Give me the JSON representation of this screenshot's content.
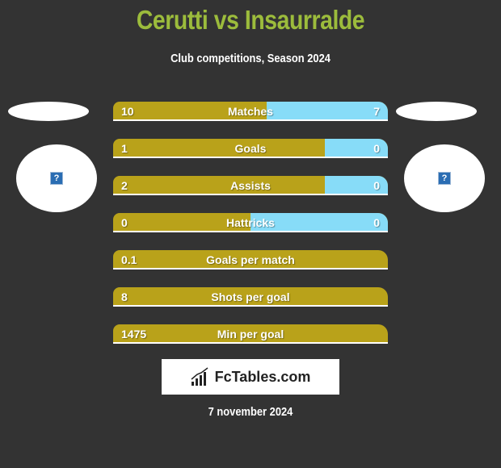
{
  "header": {
    "title": "Cerutti vs Insaurralde",
    "subtitle": "Club competitions, Season 2024"
  },
  "players": {
    "left": {
      "image_icon": "broken-image-icon",
      "icon_glyph": "?"
    },
    "right": {
      "image_icon": "broken-image-icon",
      "icon_glyph": "?"
    }
  },
  "colors": {
    "title": "#9cbc3c",
    "left_bar": "#b9a21a",
    "right_bar": "#87dcf8",
    "background": "#333333"
  },
  "stats": [
    {
      "label": "Matches",
      "left": "10",
      "right": "7",
      "left_share": 0.56
    },
    {
      "label": "Goals",
      "left": "1",
      "right": "0",
      "left_share": 0.77
    },
    {
      "label": "Assists",
      "left": "2",
      "right": "0",
      "left_share": 0.77
    },
    {
      "label": "Hattricks",
      "left": "0",
      "right": "0",
      "left_share": 0.5
    },
    {
      "label": "Goals per match",
      "left": "0.1",
      "right": "",
      "left_share": 1
    },
    {
      "label": "Shots per goal",
      "left": "8",
      "right": "",
      "left_share": 1
    },
    {
      "label": "Min per goal",
      "left": "1475",
      "right": "",
      "left_share": 1
    }
  ],
  "footer": {
    "logo_text": "FcTables.com",
    "logo_icon": "bar-chart-icon",
    "date": "7 november 2024"
  }
}
